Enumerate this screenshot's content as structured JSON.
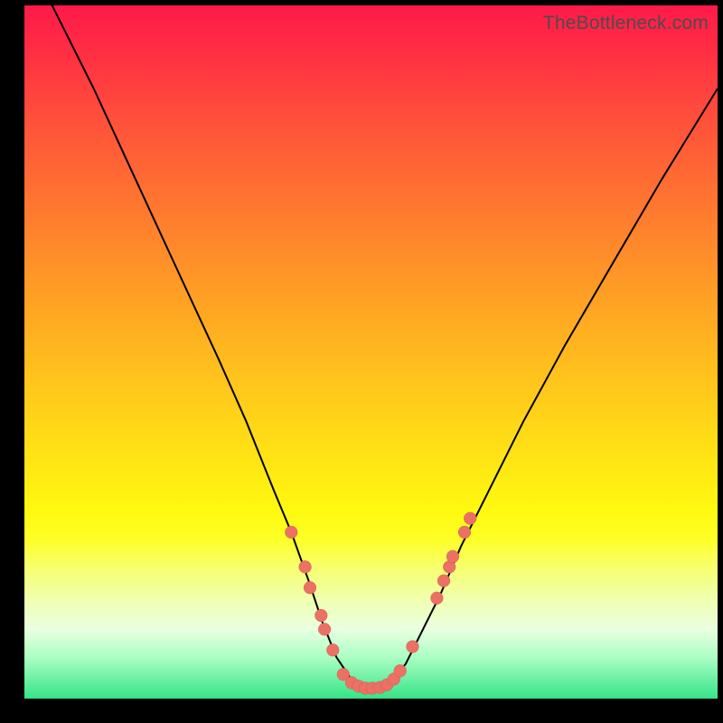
{
  "watermark": "TheBottleneck.com",
  "colors": {
    "frame": "#000000",
    "dot": "#ec7063",
    "curve": "#000000"
  },
  "chart_data": {
    "type": "line",
    "title": "",
    "xlabel": "",
    "ylabel": "",
    "xlim": [
      0,
      100
    ],
    "ylim": [
      0,
      100
    ],
    "grid": false,
    "legend": false,
    "series": [
      {
        "name": "bottleneck-curve",
        "x": [
          4,
          10,
          16,
          22,
          28,
          32,
          36,
          38.5,
          41,
          43,
          45,
          47,
          49,
          51,
          53,
          55,
          57,
          60,
          63,
          67,
          72,
          78,
          85,
          92,
          100
        ],
        "y": [
          100,
          88,
          75,
          62,
          49,
          40,
          30,
          24,
          17,
          11,
          6,
          3,
          1.5,
          1.5,
          2.5,
          5,
          9,
          15,
          22,
          30,
          40,
          51,
          63,
          75,
          88
        ]
      }
    ],
    "points": [
      {
        "x": 38.5,
        "y": 24
      },
      {
        "x": 40.5,
        "y": 19
      },
      {
        "x": 41.2,
        "y": 16
      },
      {
        "x": 42.8,
        "y": 12
      },
      {
        "x": 43.3,
        "y": 10
      },
      {
        "x": 44.5,
        "y": 7
      },
      {
        "x": 46.0,
        "y": 3.5
      },
      {
        "x": 47.2,
        "y": 2.3
      },
      {
        "x": 48.2,
        "y": 1.8
      },
      {
        "x": 49.2,
        "y": 1.5
      },
      {
        "x": 50.2,
        "y": 1.5
      },
      {
        "x": 51.3,
        "y": 1.6
      },
      {
        "x": 52.3,
        "y": 2.0
      },
      {
        "x": 53.3,
        "y": 2.8
      },
      {
        "x": 54.2,
        "y": 4.0
      },
      {
        "x": 56.0,
        "y": 7.5
      },
      {
        "x": 59.5,
        "y": 14.5
      },
      {
        "x": 60.5,
        "y": 17
      },
      {
        "x": 61.3,
        "y": 19
      },
      {
        "x": 61.8,
        "y": 20.5
      },
      {
        "x": 63.5,
        "y": 24
      },
      {
        "x": 64.3,
        "y": 26
      }
    ]
  }
}
